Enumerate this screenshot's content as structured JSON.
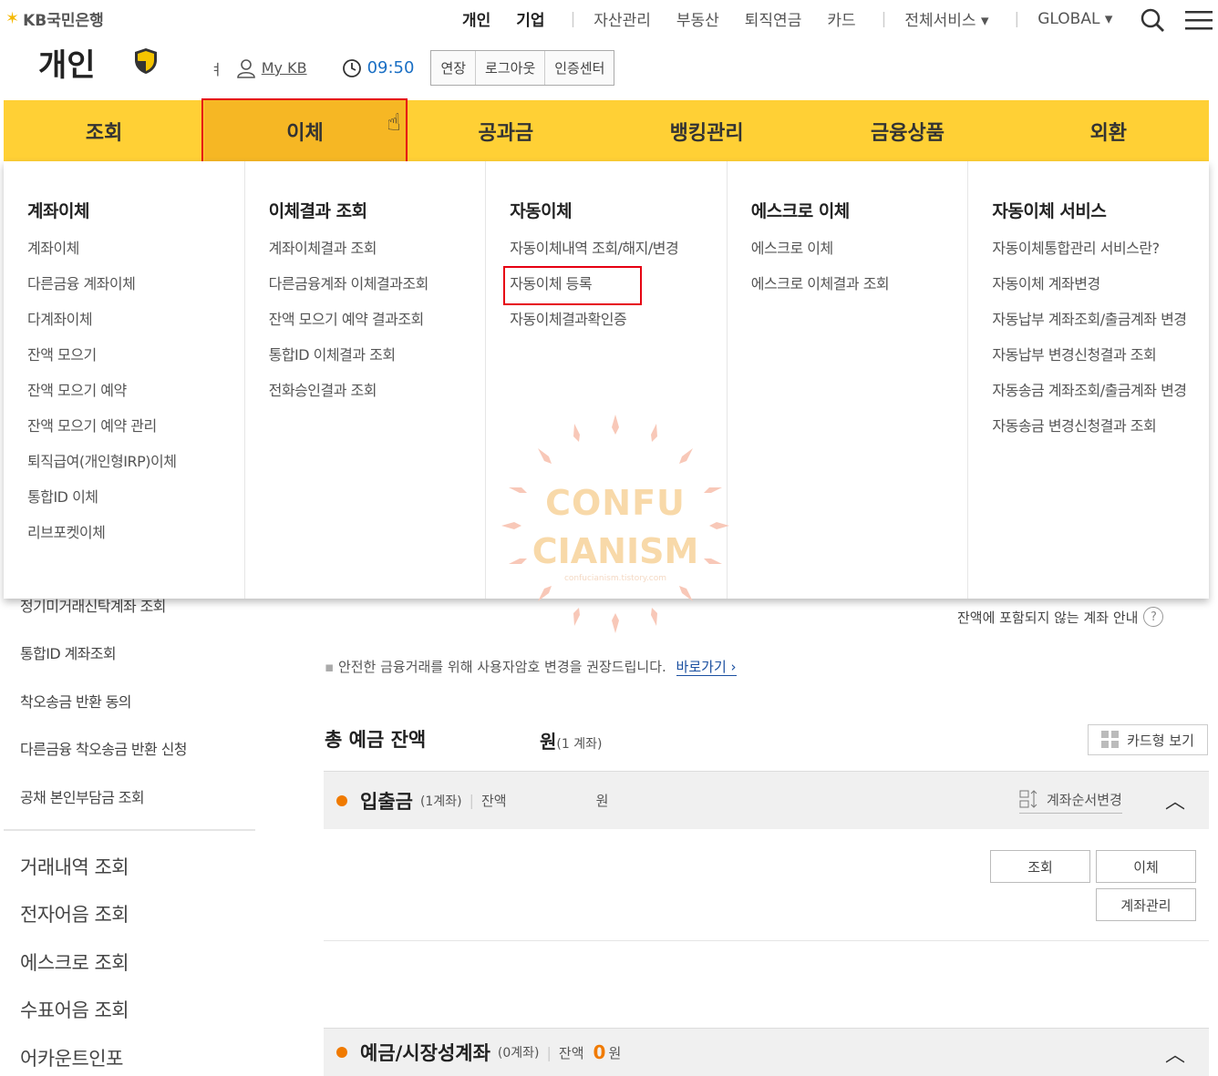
{
  "brand": {
    "logo_text": "KB국민은행"
  },
  "topnav": {
    "personal": "개인",
    "business": "기업",
    "items": [
      "자산관리",
      "부동산",
      "퇴직연금",
      "카드"
    ],
    "all_services": "전체서비스 ▾",
    "global": "GLOBAL ▾"
  },
  "page": {
    "title": "개인"
  },
  "userbar": {
    "glyph": "ㅕ",
    "mykb": "My KB",
    "time": "09:50",
    "extend": "연장",
    "logout": "로그아웃",
    "cert": "인증센터"
  },
  "mainmenu": [
    "조회",
    "이체",
    "공과금",
    "뱅킹관리",
    "금융상품",
    "외환"
  ],
  "dropdown": [
    {
      "title": "계좌이체",
      "items": [
        "계좌이체",
        "다른금융 계좌이체",
        "다계좌이체",
        "잔액 모으기",
        "잔액 모으기 예약",
        "잔액 모으기 예약 관리",
        "퇴직급여(개인형IRP)이체",
        "통합ID 이체",
        "리브포켓이체"
      ]
    },
    {
      "title": "이체결과 조회",
      "items": [
        "계좌이체결과 조회",
        "다른금융계좌 이체결과조회",
        "잔액 모으기 예약 결과조회",
        "통합ID 이체결과 조회",
        "전화승인결과 조회"
      ]
    },
    {
      "title": "자동이체",
      "items": [
        "자동이체내역 조회/해지/변경",
        "자동이체 등록",
        "자동이체결과확인증"
      ]
    },
    {
      "title": "에스크로 이체",
      "items": [
        "에스크로 이체",
        "에스크로 이체결과 조회"
      ]
    },
    {
      "title": "자동이체 서비스",
      "items": [
        "자동이체통합관리 서비스란?",
        "자동이체 계좌변경",
        "자동납부 계좌조회/출금계좌 변경",
        "자동납부 변경신청결과 조회",
        "자동송금 계좌조회/출금계좌 변경",
        "자동송금 변경신청결과 조회"
      ]
    }
  ],
  "watermark": {
    "line1": "CONFU",
    "line2": "CIANISM",
    "line3": "confucianism.tistory.com"
  },
  "sidebar": {
    "items": [
      "정기미거래신탁계좌 조회",
      "통합ID 계좌조회",
      "착오송금 반환 동의",
      "다른금융 착오송금 반환 신청",
      "공채 본인부담금 조회"
    ],
    "big": [
      "거래내역 조회",
      "전자어음 조회",
      "에스크로 조회",
      "수표어음 조회",
      "어카운트인포"
    ]
  },
  "content": {
    "hint": "잔액에 포함되지 않는 계좌 안내",
    "notice": "안전한 금융거래를 위해 사용자암호 변경을 권장드립니다.",
    "notice_link": "바로가기 ›",
    "total_label": "총 예금 잔액",
    "total_unit": "원",
    "total_count": "(1 계좌)",
    "card_view": "카드형 보기",
    "sec1": {
      "name": "입출금",
      "count": "(1계좌)",
      "balance_label": "잔액",
      "unit": "원",
      "reorder": "계좌순서변경"
    },
    "buttons": {
      "inquiry": "조회",
      "transfer": "이체",
      "manage": "계좌관리"
    },
    "sec2": {
      "name": "예금/시장성계좌",
      "count": "(0계좌)",
      "balance_label": "잔액",
      "amount": "0",
      "unit": "원"
    }
  },
  "colors": {
    "menu_yellow": "#ffd035",
    "menu_active": "#f6b724",
    "highlight": "#e60012",
    "accent_orange": "#f07a00",
    "time_blue": "#1a6fc4"
  }
}
